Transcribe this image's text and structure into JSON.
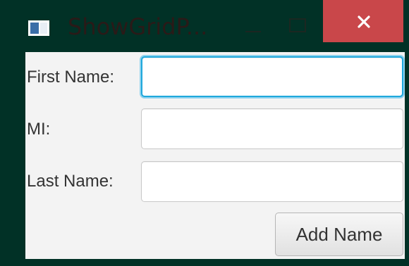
{
  "window": {
    "title": "ShowGridP...",
    "icon": "java-app-icon",
    "controls": {
      "minimize_icon": "minimize-icon",
      "maximize_icon": "maximize-icon",
      "close_icon": "close-icon"
    }
  },
  "form": {
    "fields": [
      {
        "label": "First Name:",
        "value": "",
        "placeholder": ""
      },
      {
        "label": "MI:",
        "value": "",
        "placeholder": ""
      },
      {
        "label": "Last Name:",
        "value": "",
        "placeholder": ""
      }
    ],
    "submit_label": "Add Name"
  },
  "colors": {
    "titlebar_background": "#013126",
    "close_button": "#c9474a",
    "focus_ring": "#1fa8dc",
    "content_background": "#f3f3f3"
  }
}
